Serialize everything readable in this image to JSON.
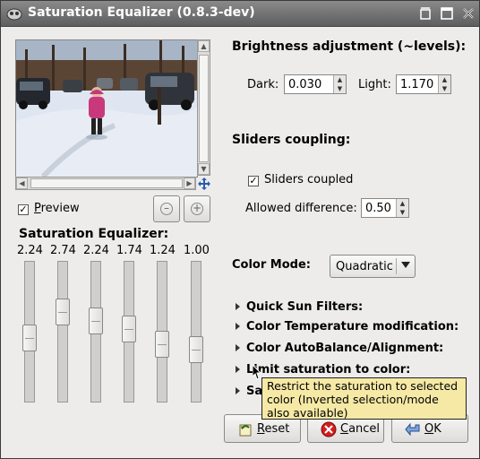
{
  "window": {
    "title": "Saturation Equalizer (0.8.3-dev)"
  },
  "preview": {
    "checkbox_label": "Preview",
    "checked": true,
    "mnemonic_char": "P",
    "label_rest": "review"
  },
  "saturation": {
    "heading": "Saturation Equalizer:",
    "sliders": [
      {
        "value": "2.24",
        "level": 0.45
      },
      {
        "value": "2.74",
        "level": 0.68
      },
      {
        "value": "2.24",
        "level": 0.6
      },
      {
        "value": "1.74",
        "level": 0.53
      },
      {
        "value": "1.24",
        "level": 0.4
      },
      {
        "value": "1.00",
        "level": 0.35
      }
    ]
  },
  "brightness": {
    "heading": "Brightness adjustment (~levels):",
    "dark_label": "Dark:",
    "dark_value": "0.030",
    "light_label": "Light:",
    "light_value": "1.170"
  },
  "coupling": {
    "heading": "Sliders coupling:",
    "checkbox_label": "Sliders coupled",
    "checked": true,
    "allowed_label": "Allowed difference:",
    "allowed_value": "0.50"
  },
  "color_mode": {
    "label": "Color Mode:",
    "selected": "Quadratic"
  },
  "expanders": [
    {
      "label": "Quick Sun Filters:"
    },
    {
      "label": "Color Temperature modification:"
    },
    {
      "label": "Color AutoBalance/Alignment:"
    },
    {
      "label": "Limit saturation to color:"
    },
    {
      "label": "Sa"
    }
  ],
  "tooltip": {
    "text": "Restrict the saturation to selected color (Inverted selection/mode also available)"
  },
  "buttons": {
    "reset_mn": "R",
    "reset_rest": "eset",
    "cancel_mn": "C",
    "cancel_rest": "ancel",
    "ok_mn": "O",
    "ok_rest": "K"
  },
  "colors": {
    "title_bg": "#5e5e5e",
    "window_bg": "#edeceb",
    "tooltip_bg": "#f5e9a5",
    "cancel_red": "#d21e1e"
  }
}
